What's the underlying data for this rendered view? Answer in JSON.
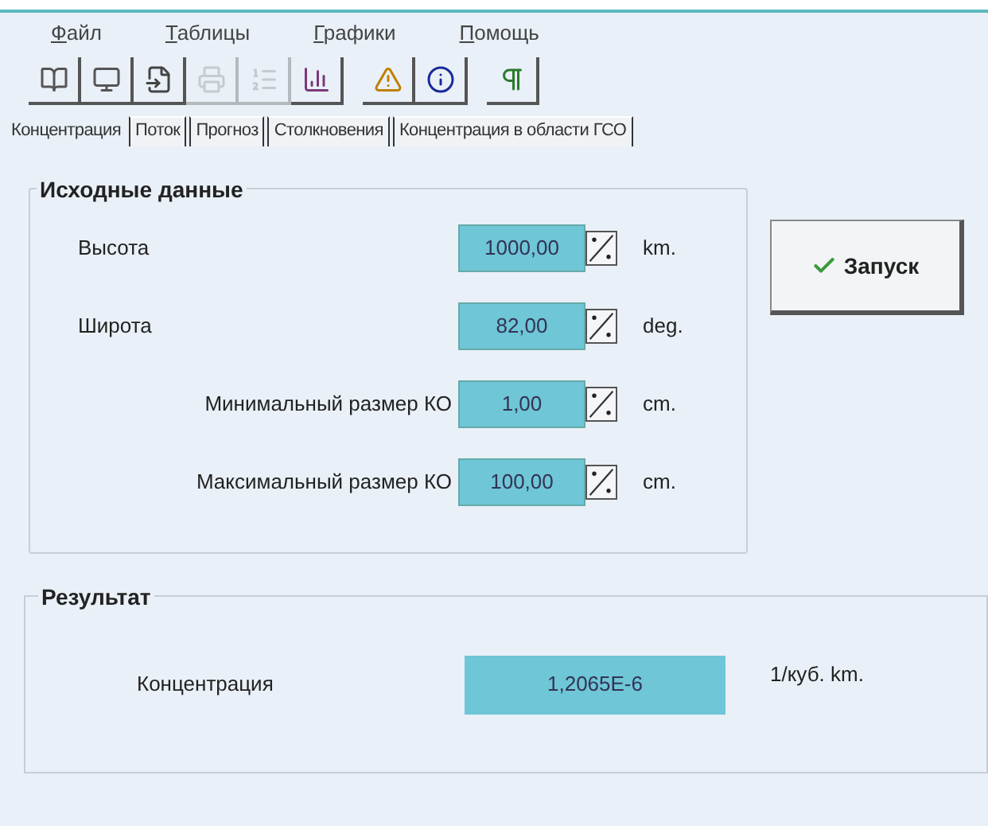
{
  "menu": [
    "Файл",
    "Таблицы",
    "Графики",
    "Помощь"
  ],
  "toolbar": [
    [
      {
        "disabled": false
      },
      {
        "disabled": false
      },
      {
        "disabled": false
      },
      {
        "disabled": true
      },
      {
        "disabled": true
      },
      {
        "disabled": false
      }
    ],
    [
      {
        "disabled": false
      },
      {
        "disabled": false
      }
    ],
    [
      {
        "disabled": false
      }
    ]
  ],
  "tabs": [
    {
      "label": "Концентрация",
      "selected": true
    },
    {
      "label": "Поток",
      "selected": false
    },
    {
      "label": "Прогноз",
      "selected": false
    },
    {
      "label": "Столкновения",
      "selected": false
    },
    {
      "label": "Концентрация в области ГСО",
      "selected": false
    }
  ],
  "input_group": {
    "title": "Исходные данные",
    "fields": [
      {
        "label": "Высота",
        "value": "1000,00",
        "unit": "km."
      },
      {
        "label": "Широта",
        "value": "82,00",
        "unit": "deg."
      },
      {
        "label": "Минимальный размер КО",
        "value": "1,00",
        "unit": "cm."
      },
      {
        "label": "Максимальный размер КО",
        "value": "100,00",
        "unit": "cm."
      }
    ]
  },
  "run_button": "Запуск",
  "result_group": {
    "title": "Результат",
    "label": "Концентрация",
    "value": "1,2065E-6",
    "unit": "1/куб. km."
  }
}
